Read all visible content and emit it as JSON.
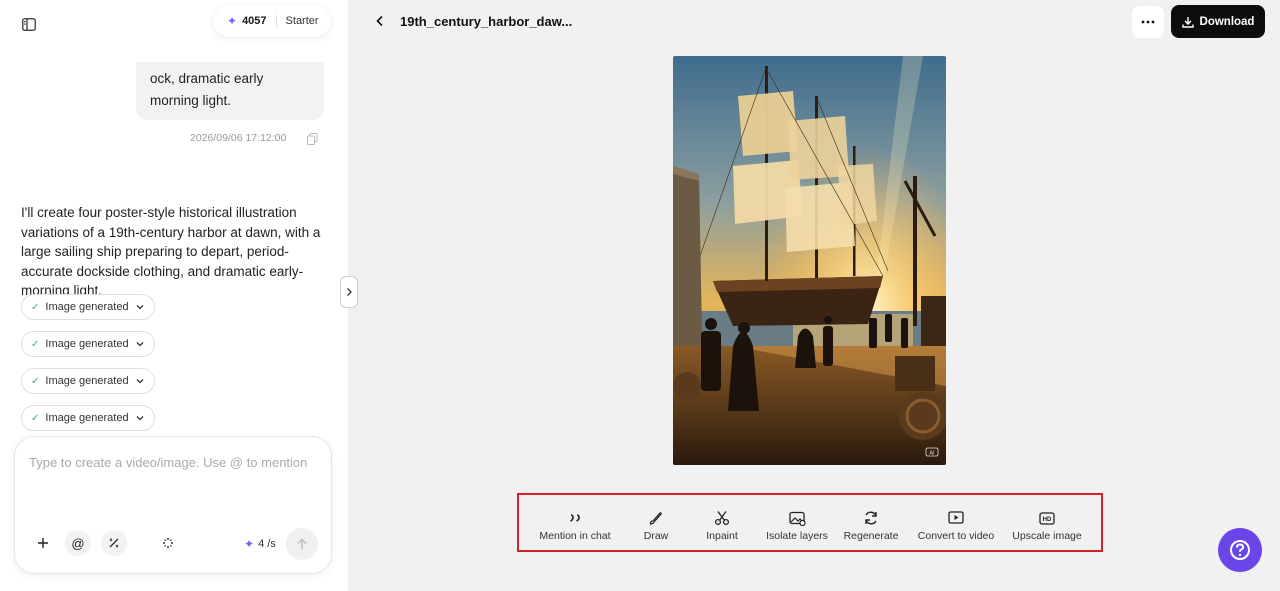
{
  "credits": {
    "count": "4057",
    "plan": "Starter"
  },
  "chat": {
    "user_message": "ock, dramatic early morning light.",
    "timestamp": "2026/09/06 17:12:00",
    "assistant_message": "I'll create four poster-style historical illustration variations of a 19th-century harbor at dawn, with a large sailing ship preparing to depart, period-accurate dockside clothing, and dramatic early-morning light.",
    "generated_items": [
      {
        "label": "Image generated"
      },
      {
        "label": "Image generated"
      },
      {
        "label": "Image generated"
      },
      {
        "label": "Image generated"
      }
    ]
  },
  "composer": {
    "placeholder": "Type to create a video/image. Use @ to mention",
    "rate": "4 /s"
  },
  "viewer": {
    "title": "19th_century_harbor_daw...",
    "download_label": "Download",
    "toolbar": [
      {
        "label": "Mention in chat",
        "icon": "quote-icon"
      },
      {
        "label": "Draw",
        "icon": "brush-icon"
      },
      {
        "label": "Inpaint",
        "icon": "scissors-icon"
      },
      {
        "label": "Isolate layers",
        "icon": "layers-image-icon"
      },
      {
        "label": "Regenerate",
        "icon": "refresh-icon"
      },
      {
        "label": "Convert to video",
        "icon": "video-play-icon"
      },
      {
        "label": "Upscale image",
        "icon": "hd-icon"
      }
    ],
    "image_badge": "AI"
  },
  "colors": {
    "accent": "#7c5cff",
    "help": "#6a45e8",
    "highlight": "#d6212a"
  }
}
